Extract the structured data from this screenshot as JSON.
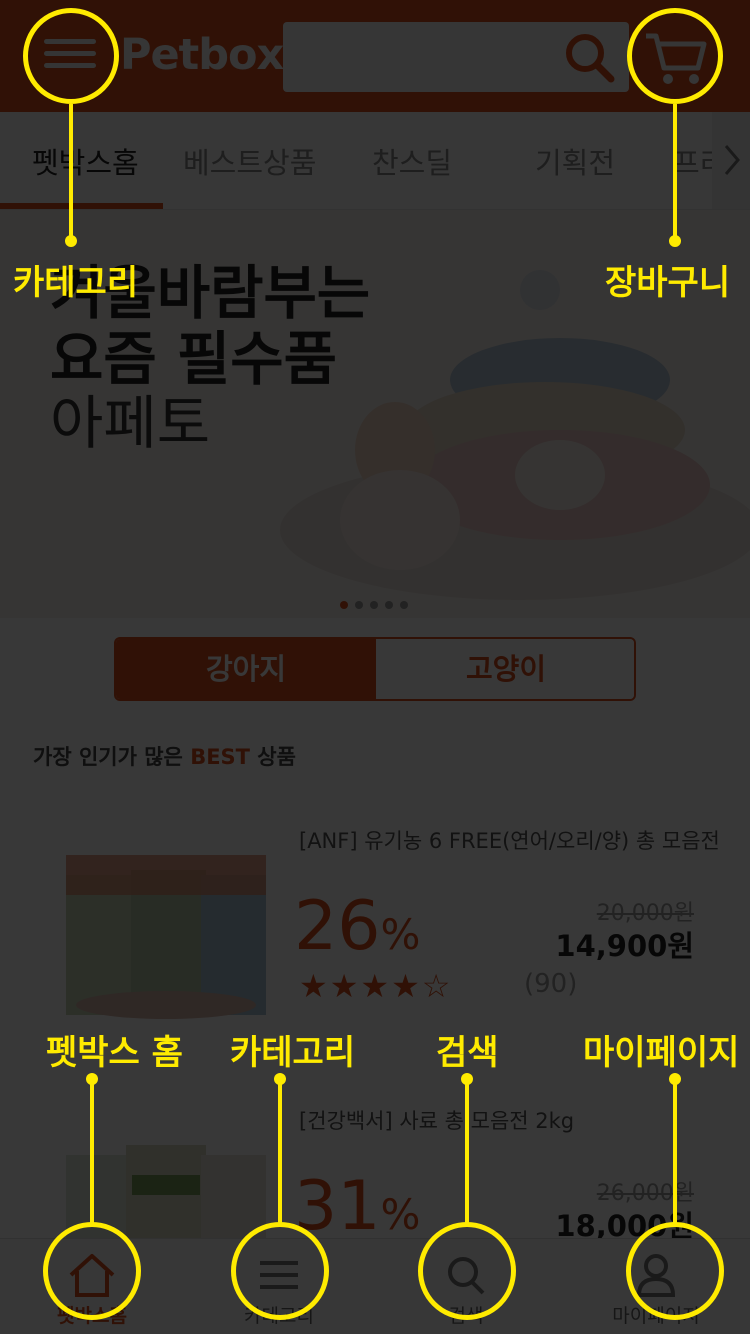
{
  "colors": {
    "brand": "#d9501e",
    "overlay": "#000000",
    "annotation": "#ffeb00"
  },
  "header": {
    "logo": "Petbox",
    "search_placeholder": "",
    "menu_icon": "hamburger-icon",
    "search_icon": "search-icon",
    "cart_icon": "cart-icon"
  },
  "tabs": [
    {
      "label": "펫박스홈",
      "active": true
    },
    {
      "label": "베스트상품",
      "active": false
    },
    {
      "label": "찬스딜",
      "active": false
    },
    {
      "label": "기획전",
      "active": false
    },
    {
      "label": "프리미",
      "active": false
    }
  ],
  "banner": {
    "line1": "겨울바람부는",
    "line2": "요즘 필수품",
    "line3": "아페토",
    "slides": 5,
    "active_slide": 1
  },
  "pet_toggle": {
    "dog": "강아지",
    "cat": "고양이",
    "selected": "dog"
  },
  "best": {
    "prefix": "가장 인기가 많은 ",
    "accent": "BEST",
    "suffix": " 상품"
  },
  "products": [
    {
      "name": "[ANF] 유기농 6 FREE(연어/오리/양) 총 모음전",
      "discount": "26",
      "pct": "%",
      "original_price": "20,000원",
      "price": "14,900원",
      "rating": 4,
      "stars_filled": "★★★★",
      "stars_empty": "☆",
      "reviews": "(90)"
    },
    {
      "name": "[건강백서] 사료 총 모음전 2kg",
      "discount": "31",
      "pct": "%",
      "original_price": "26,000원",
      "price": "18,000원"
    }
  ],
  "bottom_bar": [
    {
      "label": "펫박스홈",
      "icon": "home-icon",
      "active": true
    },
    {
      "label": "카테고리",
      "icon": "menu-icon",
      "active": false
    },
    {
      "label": "검색",
      "icon": "search-icon",
      "active": false
    },
    {
      "label": "마이페이지",
      "icon": "person-icon",
      "active": false
    }
  ],
  "annotations": {
    "category_top": "카테고리",
    "cart": "장바구니",
    "home": "펫박스 홈",
    "category_bottom": "카테고리",
    "search": "검색",
    "mypage": "마이페이지"
  }
}
